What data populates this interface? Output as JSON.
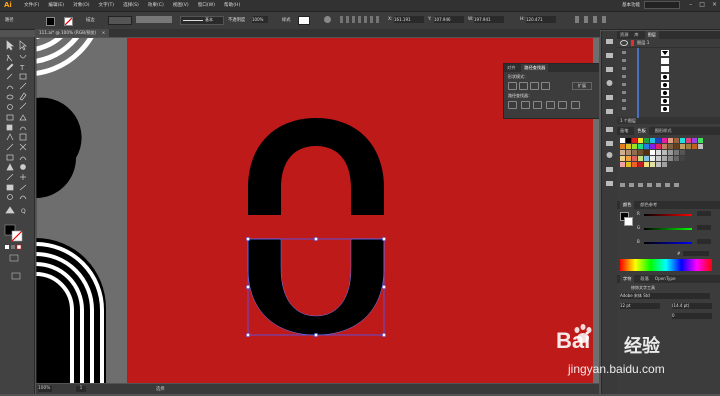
{
  "menubar": {
    "logo": "Ai",
    "items": [
      "文件(F)",
      "编辑(E)",
      "对象(O)",
      "文字(T)",
      "选择(S)",
      "效果(C)",
      "视图(V)",
      "窗口(W)",
      "帮助(H)"
    ],
    "right_tag": "基本功能"
  },
  "ctrlbar": {
    "label": "路径",
    "stroke_label": "描边",
    "brush_label": "基本",
    "opacity_label": "不透明度",
    "opacity_value": "100%",
    "style_label": "样式",
    "x_value": "161.191",
    "y_value": "107.946",
    "w_value": "197.941",
    "h_value": "120.471"
  },
  "doc_tab": "111.ai* @ 100% (RGB/预览)",
  "status": {
    "zoom": "100%",
    "page": "1",
    "tool": "选择"
  },
  "pathfinder_panel": {
    "tabs": [
      "对齐",
      "路径查找器"
    ],
    "shape_modes_label": "形状模式：",
    "expand_label": "扩展",
    "pathfinders_label": "路径查找器："
  },
  "layers_panel": {
    "tabs": [
      "资源",
      "库",
      "图层"
    ],
    "layer_name": "图层 1",
    "footer": "1 个图层"
  },
  "swatches_panel": {
    "tabs": [
      "画笔",
      "色板",
      "图形样式"
    ]
  },
  "color_panel": {
    "tabs": [
      "颜色",
      "颜色参考"
    ],
    "channels": [
      "R",
      "G",
      "B"
    ],
    "hex_label": "#"
  },
  "char_panel": {
    "tabs": [
      "字符",
      "段落",
      "OpenType"
    ],
    "tool_label": "修饰文字工具",
    "font": "Adobe 宋体 Std",
    "size": "12 pt",
    "leading": "(14.4 pt)",
    "tracking": "0"
  },
  "watermark": {
    "brand": "Bai",
    "brand2": "经验",
    "url": "jingyan.baidu.com"
  },
  "colors": {
    "artboard": "#be1a1a",
    "selection": "#4a5cff",
    "accent": "#f7a21b"
  }
}
